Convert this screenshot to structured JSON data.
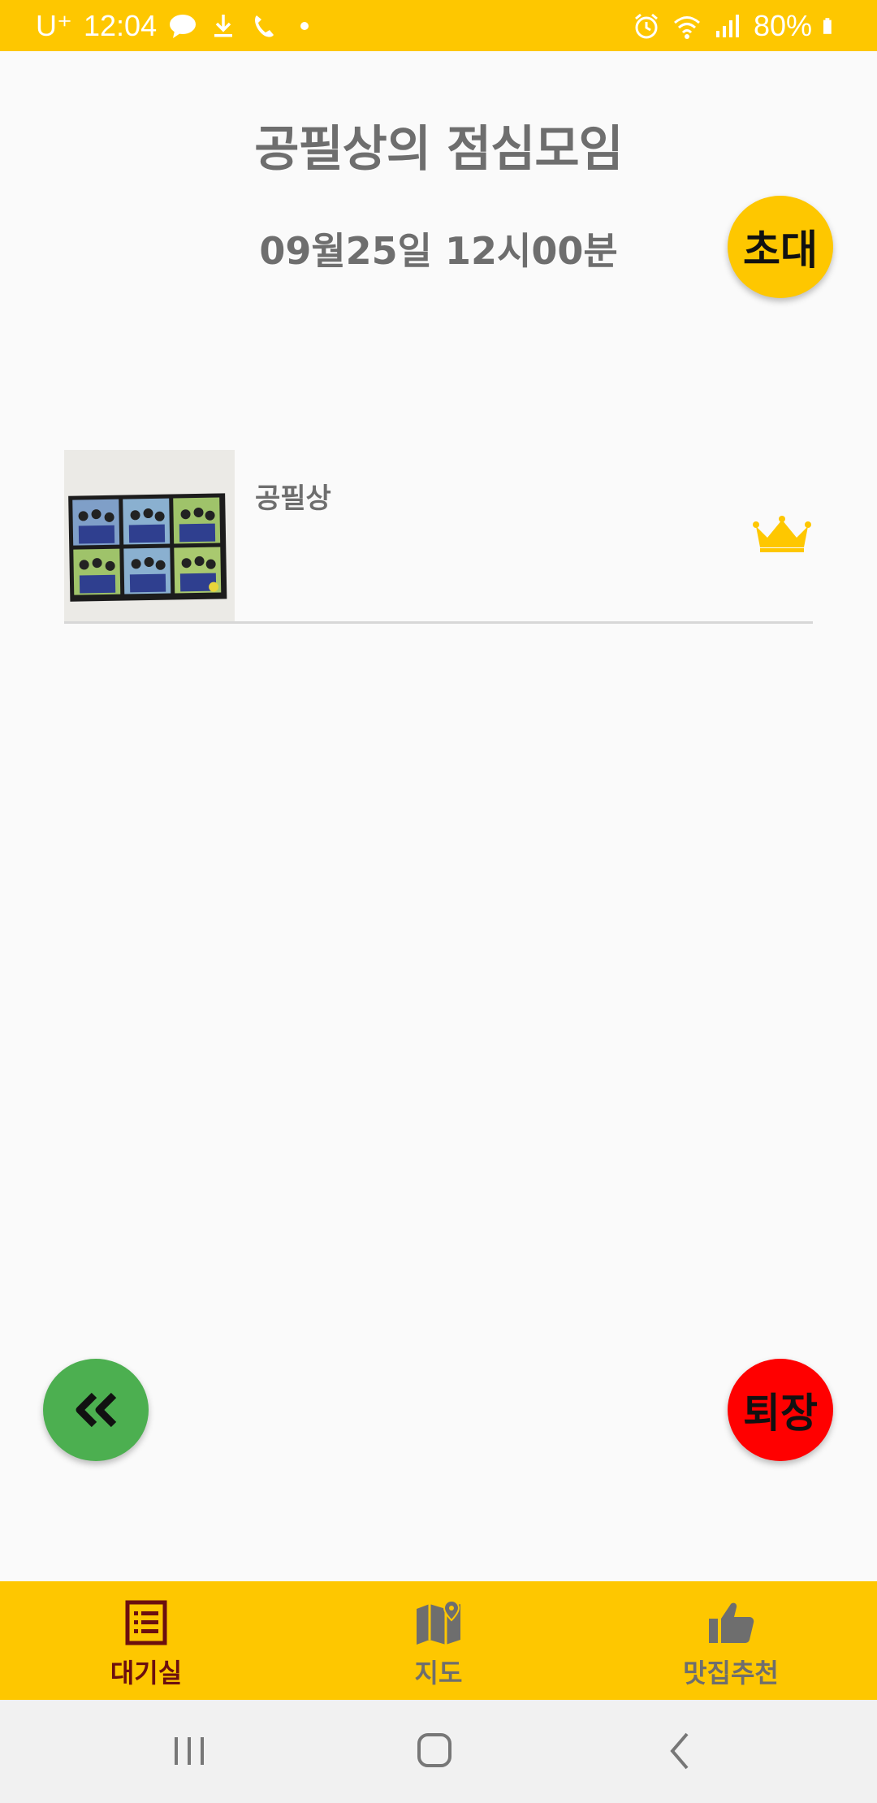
{
  "status_bar": {
    "carrier": "U⁺",
    "time": "12:04",
    "battery": "80%",
    "left_icons": [
      "talk-icon",
      "download-icon",
      "call-icon",
      "dot-icon"
    ],
    "right_icons": [
      "alarm-icon",
      "wifi-icon",
      "signal-icon",
      "battery-icon"
    ]
  },
  "room": {
    "title": "공필상의 점심모임",
    "datetime": "09월25일 12시00분"
  },
  "buttons": {
    "invite_label": "초대",
    "back_label": "‹‹",
    "leave_label": "퇴장"
  },
  "members": [
    {
      "name": "공필상",
      "is_host": true,
      "badge_icon": "crown-icon"
    }
  ],
  "bottom_nav": {
    "items": [
      {
        "label": "대기실",
        "icon": "list-icon",
        "active": true
      },
      {
        "label": "지도",
        "icon": "map-icon",
        "active": false
      },
      {
        "label": "맛집추천",
        "icon": "thumbs-up-icon",
        "active": false
      }
    ]
  },
  "system_nav": [
    "recent-apps-icon",
    "home-icon",
    "back-icon"
  ],
  "colors": {
    "accent": "#fec700",
    "back_button": "#4caf50",
    "leave_button": "#ff0000",
    "text_gray": "#6e6e6e",
    "active_nav": "#6b0f0f"
  }
}
